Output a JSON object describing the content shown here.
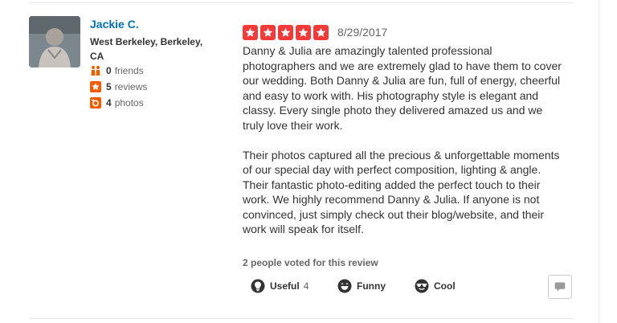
{
  "user": {
    "name": "Jackie C.",
    "location": "West Berkeley, Berkeley, CA",
    "friends": {
      "count": "0",
      "label": "friends",
      "icon": "friends-icon"
    },
    "reviews": {
      "count": "5",
      "label": "reviews",
      "icon": "star-icon"
    },
    "photos": {
      "count": "4",
      "label": "photos",
      "icon": "camera-icon"
    }
  },
  "review": {
    "rating": 5,
    "rating_color": "#f43939",
    "date": "8/29/2017",
    "paragraphs": [
      "Danny & Julia are amazingly talented professional photographers and we are extremely glad to have them to cover our wedding. Both Danny & Julia are fun, full of energy, cheerful and easy to work with. His photography style is elegant and classy. Every single photo they delivered amazed us and we truly love their work.",
      "Their photos captured all the precious & unforgettable moments of our special day with perfect composition, lighting & angle. Their fantastic photo-editing added the perfect touch to their work. We highly recommend Danny & Julia. If anyone is not convinced, just simply check out their blog/website, and their work will speak for itself."
    ]
  },
  "votes": {
    "summary": "2 people voted for this review",
    "useful": {
      "label": "Useful",
      "count": "4",
      "icon": "lightbulb-icon"
    },
    "funny": {
      "label": "Funny",
      "icon": "smiley-icon"
    },
    "cool": {
      "label": "Cool",
      "icon": "sunglasses-face-icon"
    }
  },
  "comment_icon": "speech-bubble-icon",
  "link_color": "#0073bb"
}
